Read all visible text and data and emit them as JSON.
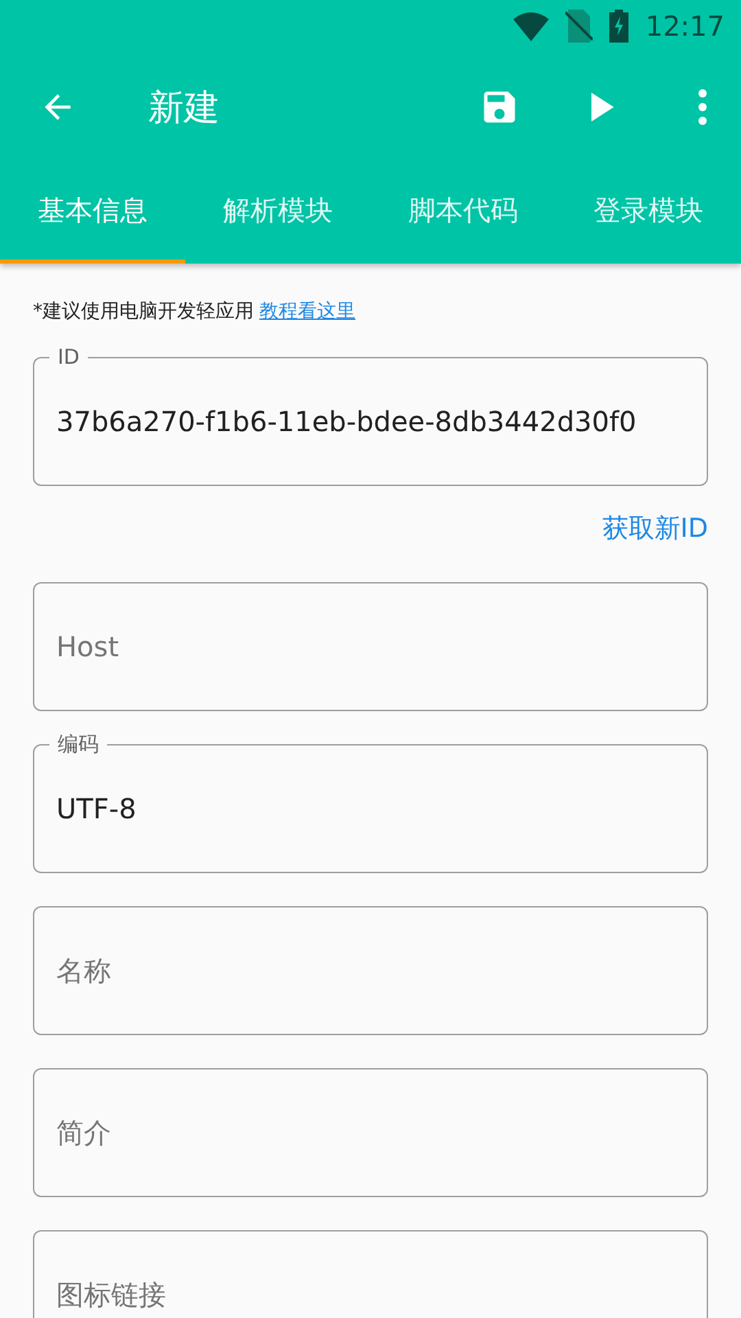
{
  "status_bar": {
    "time": "12:17"
  },
  "toolbar": {
    "title": "新建"
  },
  "tabs": [
    {
      "label": "基本信息",
      "selected": true
    },
    {
      "label": "解析模块",
      "selected": false
    },
    {
      "label": "脚本代码",
      "selected": false
    },
    {
      "label": "登录模块",
      "selected": false
    }
  ],
  "hint": {
    "text": "*建议使用电脑开发轻应用",
    "link": "教程看这里"
  },
  "fields": [
    {
      "label": "ID",
      "value": "37b6a270-f1b6-11eb-bdee-8db3442d30f0",
      "action": "获取新ID"
    },
    {
      "placeholder": "Host"
    },
    {
      "label": "编码",
      "value": "UTF-8"
    },
    {
      "placeholder": "名称"
    },
    {
      "placeholder": "简介"
    },
    {
      "placeholder": "图标链接"
    }
  ]
}
